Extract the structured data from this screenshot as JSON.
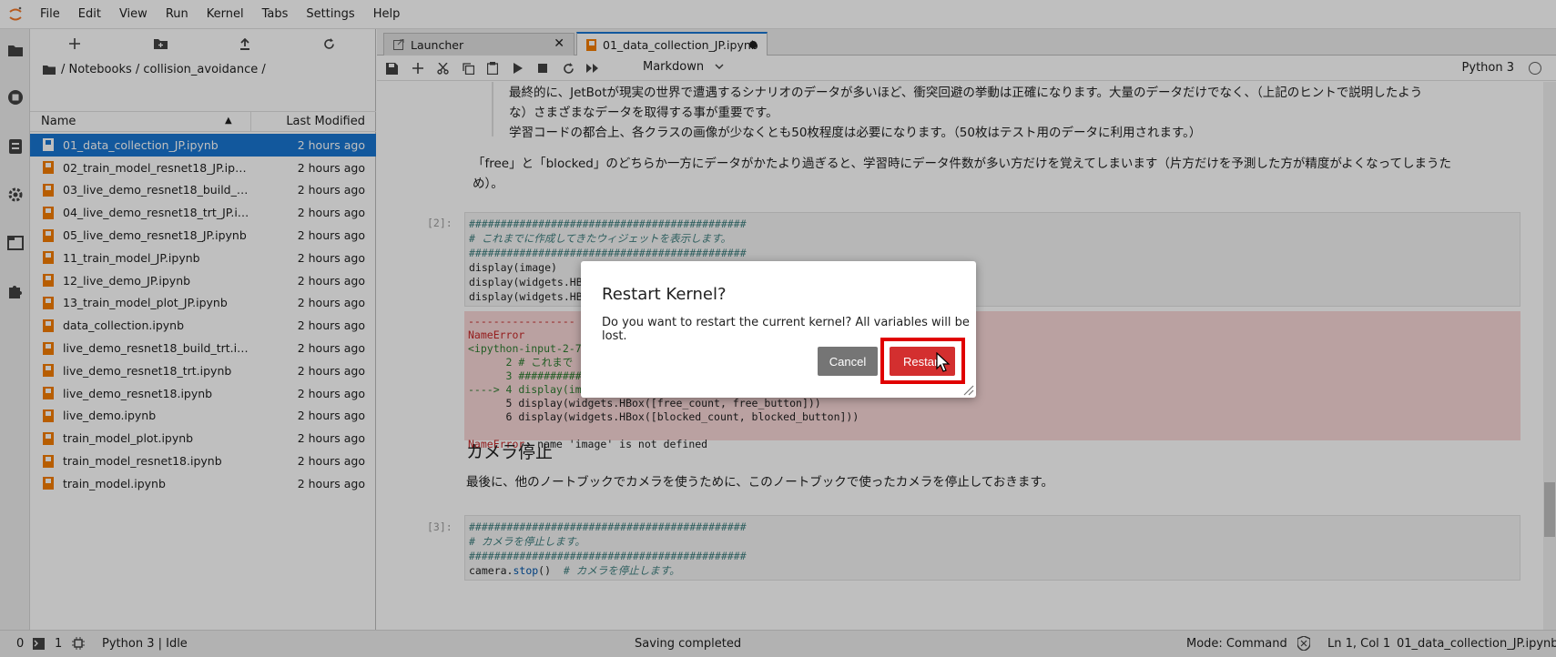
{
  "menu": [
    "File",
    "Edit",
    "View",
    "Run",
    "Kernel",
    "Tabs",
    "Settings",
    "Help"
  ],
  "colors": {
    "accent": "#1976d2",
    "danger": "#d32f2f",
    "notebook_icon": "#f57c00",
    "error_bg": "#f9d7d7"
  },
  "activity_icons": [
    "folder-icon",
    "running-icon",
    "commands-icon",
    "settings-icon",
    "tabs-icon",
    "extension-icon"
  ],
  "filebrowser": {
    "breadcrumb": "/ Notebooks / collision_avoidance /",
    "header": {
      "name": "Name",
      "modified": "Last Modified"
    },
    "files": [
      {
        "name": "01_data_collection_JP.ipynb",
        "modified": "2 hours ago"
      },
      {
        "name": "02_train_model_resnet18_JP.ipynb",
        "modified": "2 hours ago"
      },
      {
        "name": "03_live_demo_resnet18_build_trt_J...",
        "modified": "2 hours ago"
      },
      {
        "name": "04_live_demo_resnet18_trt_JP.ipynb",
        "modified": "2 hours ago"
      },
      {
        "name": "05_live_demo_resnet18_JP.ipynb",
        "modified": "2 hours ago"
      },
      {
        "name": "11_train_model_JP.ipynb",
        "modified": "2 hours ago"
      },
      {
        "name": "12_live_demo_JP.ipynb",
        "modified": "2 hours ago"
      },
      {
        "name": "13_train_model_plot_JP.ipynb",
        "modified": "2 hours ago"
      },
      {
        "name": "data_collection.ipynb",
        "modified": "2 hours ago"
      },
      {
        "name": "live_demo_resnet18_build_trt.ipynb",
        "modified": "2 hours ago"
      },
      {
        "name": "live_demo_resnet18_trt.ipynb",
        "modified": "2 hours ago"
      },
      {
        "name": "live_demo_resnet18.ipynb",
        "modified": "2 hours ago"
      },
      {
        "name": "live_demo.ipynb",
        "modified": "2 hours ago"
      },
      {
        "name": "train_model_plot.ipynb",
        "modified": "2 hours ago"
      },
      {
        "name": "train_model_resnet18.ipynb",
        "modified": "2 hours ago"
      },
      {
        "name": "train_model.ipynb",
        "modified": "2 hours ago"
      }
    ]
  },
  "tabs": [
    {
      "label": "Launcher"
    },
    {
      "label": "01_data_collection_JP.ipynb"
    }
  ],
  "toolbar": {
    "cell_type": "Markdown",
    "kernel": "Python 3"
  },
  "notebook": {
    "md1": "最終的に、JetBotが現実の世界で遭遇するシナリオのデータが多いほど、衝突回避の挙動は正確になります。大量のデータだけでなく、（上記のヒントで説明したよう",
    "md2": "な）さまざまなデータを取得する事が重要です。",
    "md3": "学習コードの都合上、各クラスの画像が少なくとも50枚程度は必要になります。（50枚はテスト用のデータに利用されます。）",
    "md4": "「free」と「blocked」のどちらか一方にデータがかたより過ぎると、学習時にデータ件数が多い方だけを覚えてしまいます（片方だけを予測した方が精度がよくなってしまうた",
    "md5": "め）。",
    "prompt2": "[2]:",
    "code2": {
      "l1": "############################################",
      "l2": "# これまでに作成してきたウィジェットを表示します。",
      "l3": "############################################",
      "l4": "display(image)",
      "l5": "display(widgets.HB",
      "l6": "display(widgets.HB"
    },
    "error": {
      "dashes": "-----------------",
      "name": "NameError",
      "input": "<ipython-input-2-7",
      "t2": "      2 # これまで",
      "t3": "      3 ##########",
      "t4": "----> 4 display(image)",
      "t5": "      5 display(widgets.HBox([free_count, free_button]))",
      "t6": "      6 display(widgets.HBox([blocked_count, blocked_button]))",
      "msg_name": "NameError",
      "msg": ": name 'image' is not defined"
    },
    "heading": "カメラ停止",
    "md6": "最後に、他のノートブックでカメラを使うために、このノートブックで使ったカメラを停止しておきます。",
    "prompt3": "[3]:",
    "code3": {
      "l1": "############################################",
      "l2": "# カメラを停止します。",
      "l3": "############################################",
      "l4a": "camera.",
      "l4b": "stop",
      "l4c": "()  ",
      "l4d": "# カメラを停止します。"
    }
  },
  "status": {
    "zero": "0",
    "one": "1",
    "kernel": "Python 3 | Idle",
    "saving": "Saving completed",
    "mode": "Mode: Command",
    "position": "Ln 1, Col 1",
    "file": "01_data_collection_JP.ipynb"
  },
  "dialog": {
    "title": "Restart Kernel?",
    "body": "Do you want to restart the current kernel? All variables will be lost.",
    "cancel": "Cancel",
    "restart": "Restart"
  }
}
